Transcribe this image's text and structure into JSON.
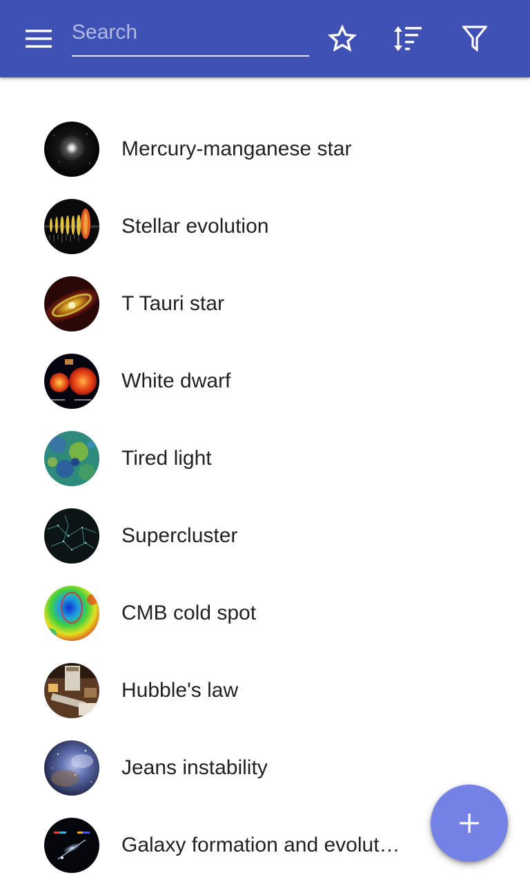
{
  "toolbar": {
    "menu_icon": "menu-icon",
    "search_placeholder": "Search",
    "search_value": "",
    "favorites_icon": "star-outline-icon",
    "sort_icon": "sort-icon",
    "filter_icon": "filter-icon",
    "background_color": "#3f51b5"
  },
  "list": {
    "items": [
      {
        "label": "Mercury-manganese star"
      },
      {
        "label": "Stellar evolution"
      },
      {
        "label": "T Tauri star"
      },
      {
        "label": "White dwarf"
      },
      {
        "label": "Tired light"
      },
      {
        "label": "Supercluster"
      },
      {
        "label": "CMB cold spot"
      },
      {
        "label": "Hubble's law"
      },
      {
        "label": "Jeans instability"
      },
      {
        "label": "Galaxy formation and evolution"
      }
    ]
  },
  "fab": {
    "icon": "plus-icon",
    "color": "#7482e6"
  }
}
